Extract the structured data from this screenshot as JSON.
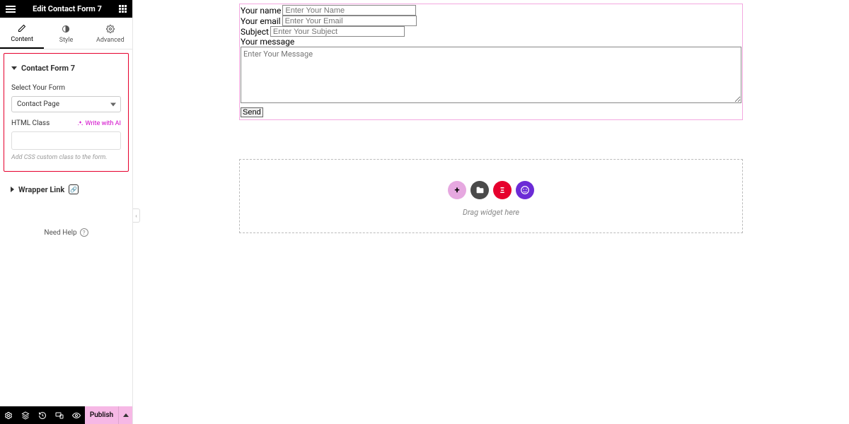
{
  "header": {
    "title": "Edit Contact Form 7"
  },
  "tabs": {
    "content": "Content",
    "style": "Style",
    "advanced": "Advanced"
  },
  "sections": {
    "cf7": {
      "title": "Contact Form 7",
      "select_label": "Select Your Form",
      "select_value": "Contact Page",
      "html_class_label": "HTML Class",
      "ai_link": "Write with AI",
      "html_class_value": "",
      "helper": "Add CSS custom class to the form."
    },
    "wrapper": {
      "title": "Wrapper Link"
    }
  },
  "need_help": "Need Help",
  "footer": {
    "publish": "Publish"
  },
  "canvas": {
    "form": {
      "name_label": "Your name",
      "name_ph": "Enter Your Name",
      "email_label": "Your email",
      "email_ph": "Enter Your Email",
      "subject_label": "Subject",
      "subject_ph": "Enter Your Subject",
      "message_label": "Your message",
      "message_ph": "Enter Your Message",
      "send": "Send"
    },
    "drop": {
      "text": "Drag widget here"
    }
  }
}
